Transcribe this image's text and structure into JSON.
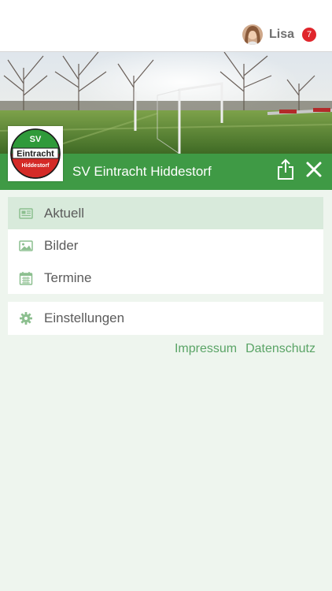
{
  "header": {
    "user_name": "Lisa",
    "notification_count": "7"
  },
  "club": {
    "name": "SV Eintracht Hiddestorf",
    "logo_text": [
      "SV",
      "Eintracht",
      "Hiddestorf"
    ]
  },
  "menu": {
    "main_items": [
      {
        "label": "Aktuell",
        "icon": "newspaper-icon",
        "active": true
      },
      {
        "label": "Bilder",
        "icon": "image-icon",
        "active": false
      },
      {
        "label": "Termine",
        "icon": "calendar-icon",
        "active": false
      }
    ],
    "settings_item": {
      "label": "Einstellungen",
      "icon": "gear-icon"
    }
  },
  "footer": {
    "impressum": "Impressum",
    "datenschutz": "Datenschutz"
  },
  "colors": {
    "brand_green": "#3f9a45",
    "badge_red": "#e0262c",
    "active_item_bg": "#d8eadb",
    "link_green": "#5aa466",
    "page_bg": "#eef5ee"
  }
}
